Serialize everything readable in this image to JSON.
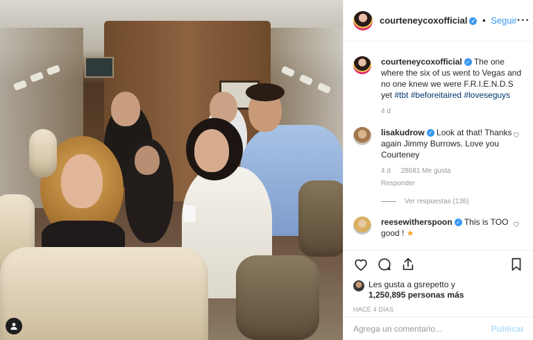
{
  "post": {
    "header": {
      "username": "courteneycoxofficial",
      "separator": "•",
      "follow_label": "Seguir",
      "more_label": "···"
    },
    "caption": {
      "username": "courteneycoxofficial",
      "text": "The one where the six of us went to Vegas and no one knew we were F.R.I.E.N.D.S yet",
      "hashtags": [
        "#tbt",
        "#beforeitaired",
        "#loveseguys"
      ],
      "time": "4 d"
    },
    "comments": [
      {
        "username": "lisakudrow",
        "text": "Look at that! Thanks again Jimmy Burrows. Love you Courteney",
        "time": "4 d",
        "likes": "28681 Me gusta",
        "reply_label": "Responder",
        "view_replies": "Ver respuestas (136)"
      },
      {
        "username": "reesewitherspoon",
        "text": "This is TOO good !",
        "emoji": "★"
      }
    ],
    "likes": {
      "line1": "Les gusta a gsrepetto y",
      "line2": "1,250,895 personas más"
    },
    "timestamp": "HACE 4 DÍAS",
    "comment_input": {
      "placeholder": "Agrega un comentario...",
      "publish_label": "Publicar"
    },
    "colors": {
      "link_blue": "#3897f0",
      "hashtag": "#003569",
      "muted": "#999999",
      "text": "#262626"
    },
    "icons": [
      "heart-icon",
      "comment-icon",
      "share-icon",
      "bookmark-icon",
      "more-icon",
      "verified-icon",
      "user-tag-icon",
      "heart-small-icon"
    ]
  }
}
